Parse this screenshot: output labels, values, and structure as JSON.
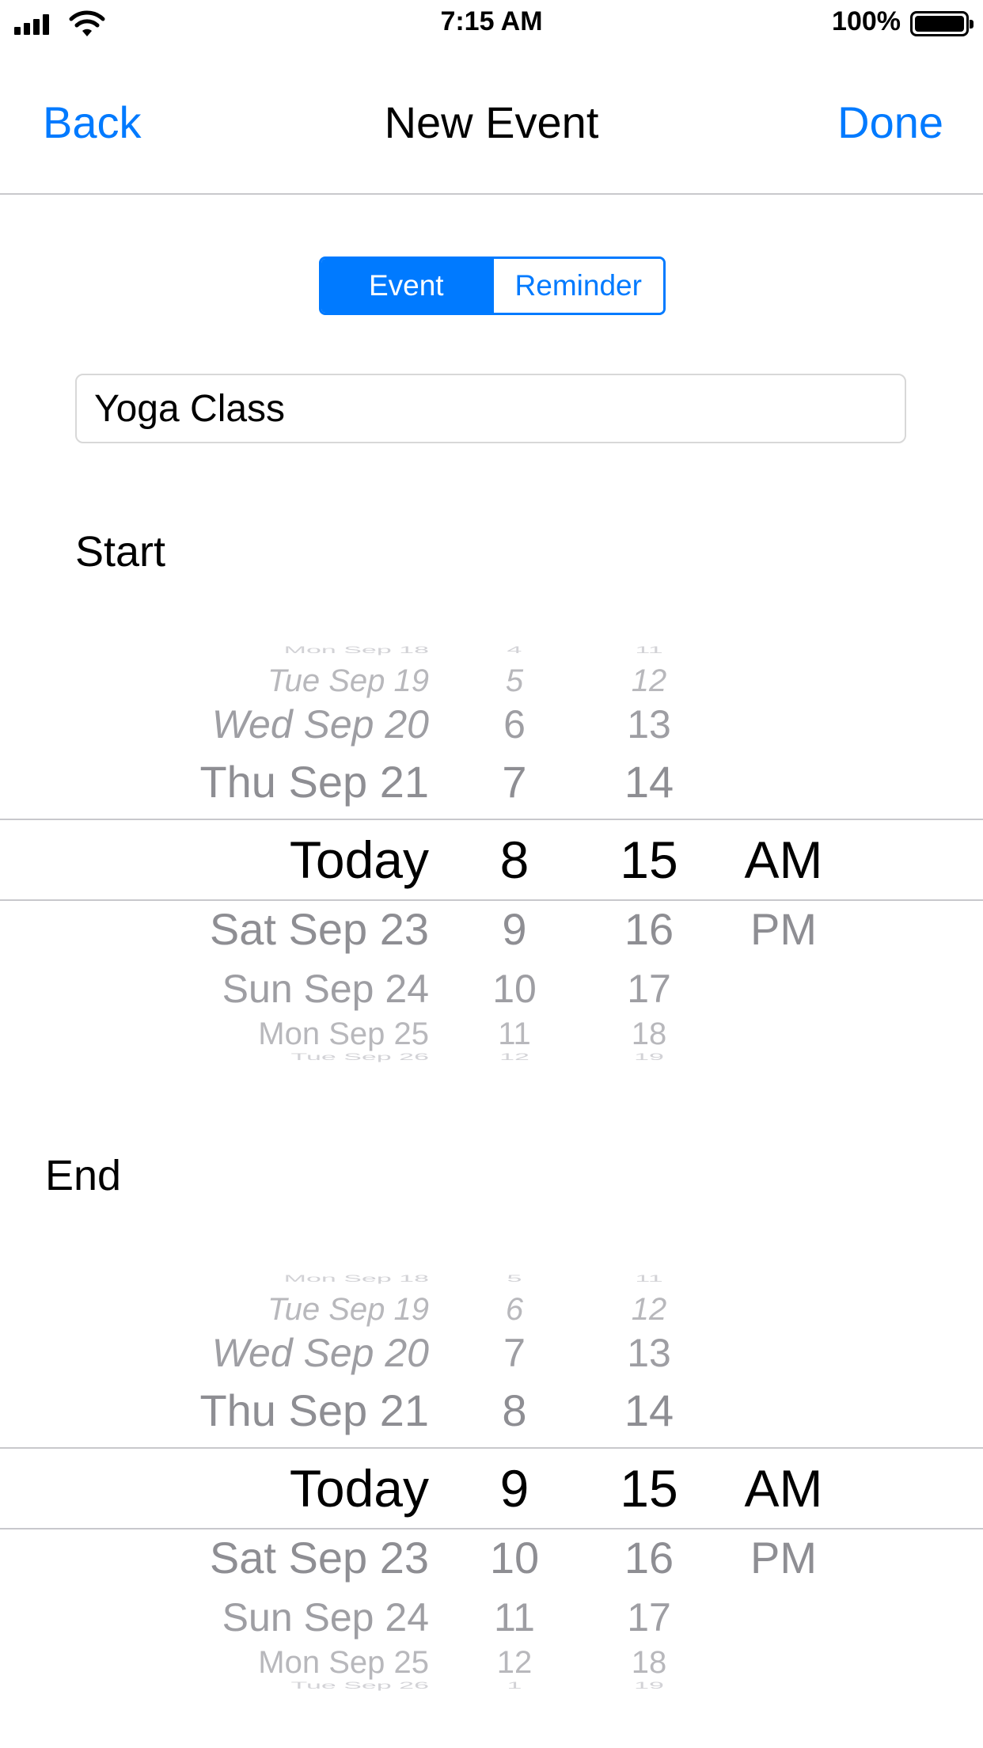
{
  "status_bar": {
    "time": "7:15 AM",
    "battery": "100%"
  },
  "nav": {
    "back": "Back",
    "title": "New Event",
    "done": "Done"
  },
  "segmented": {
    "options": [
      "Event",
      "Reminder"
    ],
    "selected": "Event"
  },
  "title_field": {
    "value": "Yoga Class"
  },
  "start": {
    "label": "Start",
    "dates": [
      "Mon Sep 18",
      "Tue Sep 19",
      "Wed Sep 20",
      "Thu Sep 21",
      "Today",
      "Sat Sep 23",
      "Sun Sep 24",
      "Mon Sep 25",
      "Tue Sep 26"
    ],
    "hours": [
      "4",
      "5",
      "6",
      "7",
      "8",
      "9",
      "10",
      "11",
      "12"
    ],
    "minutes": [
      "11",
      "12",
      "13",
      "14",
      "15",
      "16",
      "17",
      "18",
      "19"
    ],
    "ampm": [
      "AM",
      "PM"
    ]
  },
  "end": {
    "label": "End",
    "dates": [
      "Mon Sep 18",
      "Tue Sep 19",
      "Wed Sep 20",
      "Thu Sep 21",
      "Today",
      "Sat Sep 23",
      "Sun Sep 24",
      "Mon Sep 25",
      "Tue Sep 26"
    ],
    "hours": [
      "5",
      "6",
      "7",
      "8",
      "9",
      "10",
      "11",
      "12",
      "1"
    ],
    "minutes": [
      "11",
      "12",
      "13",
      "14",
      "15",
      "16",
      "17",
      "18",
      "19"
    ],
    "ampm": [
      "AM",
      "PM"
    ]
  },
  "colors": {
    "accent": "#007aff",
    "separator": "#c8c8cc",
    "picker_gray": "#8e8e93"
  },
  "icons": {
    "signal": "cellular-signal-icon",
    "wifi": "wifi-icon",
    "battery": "battery-icon"
  }
}
